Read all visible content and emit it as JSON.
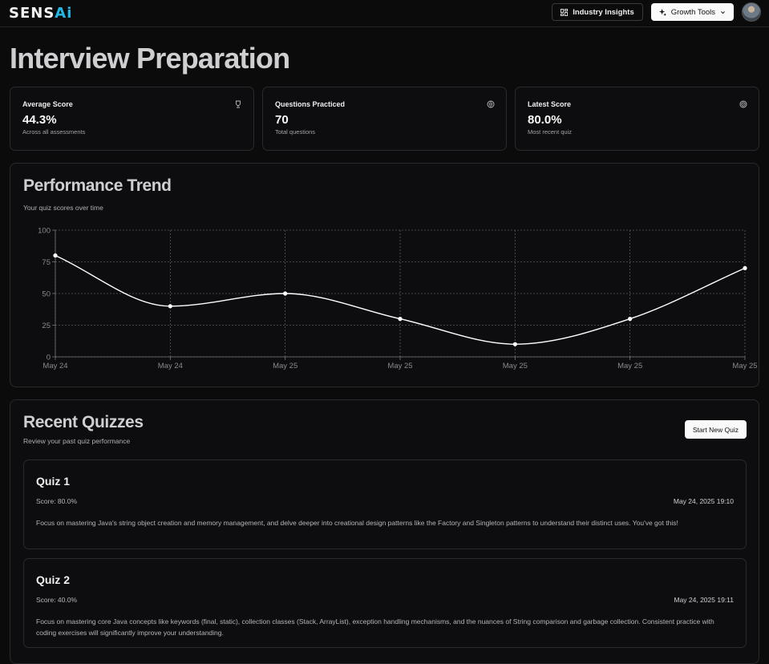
{
  "header": {
    "logo_main": "SENS",
    "logo_accent": "Ai",
    "industry_label": "Industry Insights",
    "growth_label": "Growth Tools"
  },
  "page": {
    "title": "Interview Preparation"
  },
  "stats": [
    {
      "label": "Average Score",
      "value": "44.3%",
      "sub": "Across all assessments",
      "icon": "trophy-icon"
    },
    {
      "label": "Questions Practiced",
      "value": "70",
      "sub": "Total questions",
      "icon": "brain-icon"
    },
    {
      "label": "Latest Score",
      "value": "80.0%",
      "sub": "Most recent quiz",
      "icon": "target-icon"
    }
  ],
  "trend": {
    "title": "Performance Trend",
    "description": "Your quiz scores over time"
  },
  "chart_data": {
    "type": "line",
    "x": [
      "May 24",
      "May 24",
      "May 25",
      "May 25",
      "May 25",
      "May 25",
      "May 25"
    ],
    "series": [
      {
        "values": [
          80,
          40,
          50,
          30,
          10,
          30,
          70
        ]
      }
    ],
    "ylim": [
      0,
      100
    ],
    "yticks": [
      0,
      25,
      50,
      75,
      100
    ],
    "grid": true,
    "line_color": "#ffffff"
  },
  "recent": {
    "title": "Recent Quizzes",
    "description": "Review your past quiz performance",
    "start_label": "Start New Quiz",
    "quizzes": [
      {
        "title": "Quiz 1",
        "score": "Score: 80.0%",
        "date": "May 24, 2025 19:10",
        "text": "Focus on mastering Java's string object creation and memory management, and delve deeper into creational design patterns like the Factory and Singleton patterns to understand their distinct uses. You've got this!"
      },
      {
        "title": "Quiz 2",
        "score": "Score: 40.0%",
        "date": "May 24, 2025 19:11",
        "text": "Focus on mastering core Java concepts like keywords (final, static), collection classes (Stack, ArrayList), exception handling mechanisms, and the nuances of String comparison and garbage collection. Consistent practice with coding exercises will significantly improve your understanding."
      }
    ]
  }
}
